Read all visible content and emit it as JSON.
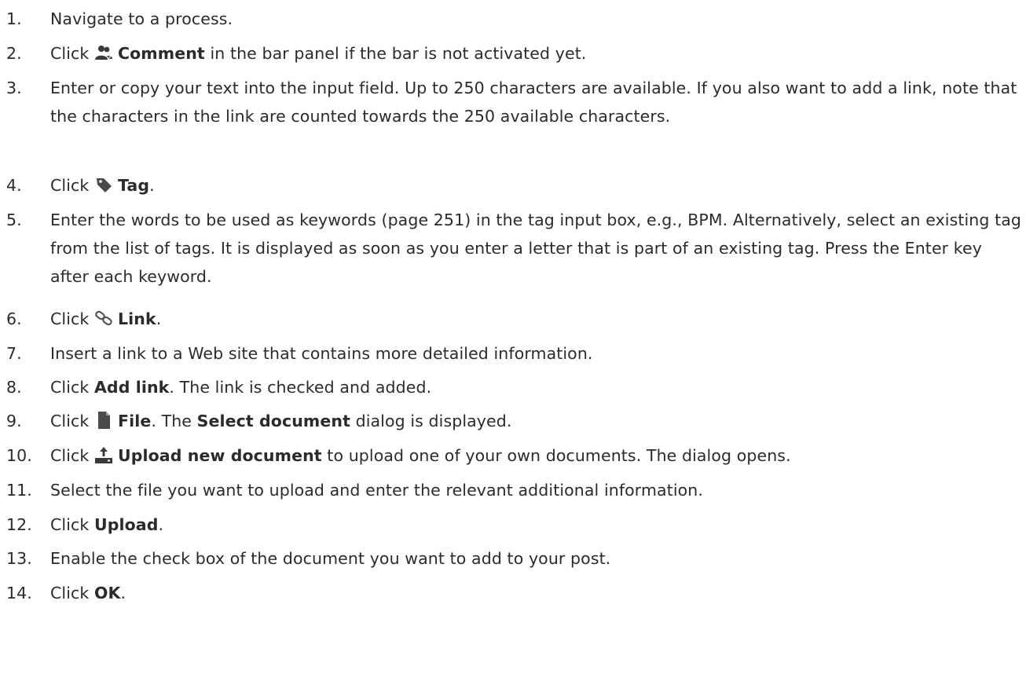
{
  "steps": [
    {
      "num": "1.",
      "text": "Navigate to a process."
    },
    {
      "num": "2.",
      "pre": "Click ",
      "icon": "users-icon",
      "bold": "Comment",
      "post": " in the bar panel if the bar is not activated yet."
    },
    {
      "num": "3.",
      "text": "Enter or copy your text into the input field. Up to 250 characters are available. If you also want to add a link, note that the characters in the link are counted towards the 250 available characters."
    },
    {
      "num": "4.",
      "pre": "Click ",
      "icon": "tag-icon",
      "bold": "Tag",
      "post": "."
    },
    {
      "num": "5.",
      "text": "Enter the words to be used as keywords (page 251) in the tag input box, e.g., BPM. Alternatively, select an existing tag from the list of tags. It is displayed as soon as you enter a letter that is part of an existing tag. Press the Enter key after each keyword."
    },
    {
      "num": "6.",
      "pre": "Click ",
      "icon": "link-icon",
      "bold": "Link",
      "post": "."
    },
    {
      "num": "7.",
      "text": "Insert a link to a Web site that contains more detailed information."
    },
    {
      "num": "8.",
      "pre": "Click ",
      "bold": "Add link",
      "post": ". The link is checked and added."
    },
    {
      "num": "9.",
      "pre": "Click ",
      "icon": "file-icon",
      "bold": "File",
      "mid": ". The ",
      "bold2": "Select document",
      "post": " dialog is displayed."
    },
    {
      "num": "10.",
      "pre": "Click ",
      "icon": "upload-icon",
      "bold": "Upload new document",
      "post": " to upload one of your own documents. The dialog opens."
    },
    {
      "num": "11.",
      "text": "Select the file you want to upload and enter the relevant additional information."
    },
    {
      "num": "12.",
      "pre": "Click ",
      "bold": "Upload",
      "post": "."
    },
    {
      "num": "13.",
      "text": "Enable the check box of the document you want to add to your post."
    },
    {
      "num": "14.",
      "pre": "Click ",
      "bold": "OK",
      "post": "."
    }
  ]
}
